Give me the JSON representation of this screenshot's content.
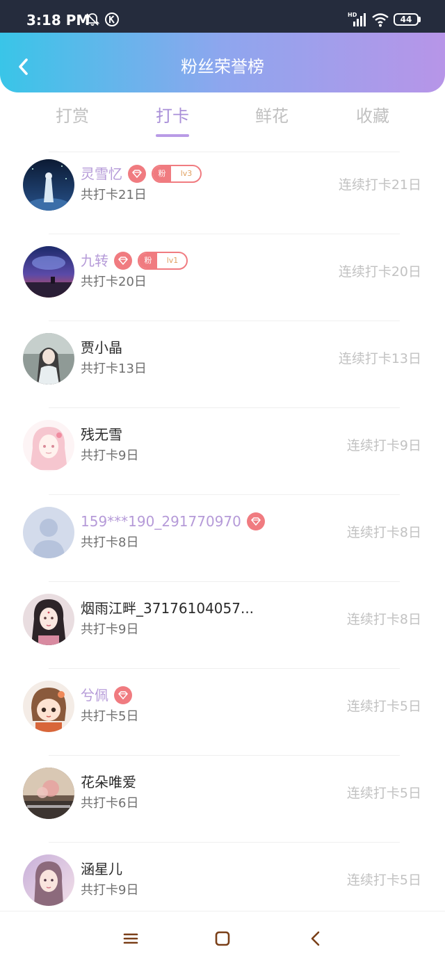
{
  "status_bar": {
    "time": "3:18 PM",
    "battery": "44",
    "icons": [
      "bell-off-icon",
      "k-icon",
      "hd-signal-icon",
      "wifi-icon",
      "battery-icon"
    ]
  },
  "header": {
    "title": "粉丝荣誉榜",
    "back_icon": "chevron-left-icon",
    "gradient": [
      "#39c5e8",
      "#b795e8"
    ]
  },
  "tabs": [
    {
      "label": "打赏",
      "active": false
    },
    {
      "label": "打卡",
      "active": true
    },
    {
      "label": "鲜花",
      "active": false
    },
    {
      "label": "收藏",
      "active": false
    }
  ],
  "fans": [
    {
      "name": "灵雪忆",
      "vip": true,
      "diamond": true,
      "fan_badge": {
        "label": "粉",
        "level": "lv3"
      },
      "total": "共打卡21日",
      "streak": "连续打卡21日"
    },
    {
      "name": "九转",
      "vip": true,
      "diamond": true,
      "fan_badge": {
        "label": "粉",
        "level": "lv1"
      },
      "total": "共打卡20日",
      "streak": "连续打卡20日"
    },
    {
      "name": "贾小晶",
      "vip": false,
      "diamond": false,
      "total": "共打卡13日",
      "streak": "连续打卡13日"
    },
    {
      "name": "残无雪",
      "vip": false,
      "diamond": false,
      "total": "共打卡9日",
      "streak": "连续打卡9日"
    },
    {
      "name": "159***190_291770970",
      "vip": true,
      "diamond": true,
      "total": "共打卡8日",
      "streak": "连续打卡8日"
    },
    {
      "name": "烟雨江畔_37176104057...",
      "vip": false,
      "diamond": false,
      "total": "共打卡9日",
      "streak": "连续打卡8日"
    },
    {
      "name": "兮佩",
      "vip": true,
      "diamond": true,
      "total": "共打卡5日",
      "streak": "连续打卡5日"
    },
    {
      "name": "花朵唯爱",
      "vip": false,
      "diamond": false,
      "total": "共打卡6日",
      "streak": "连续打卡5日"
    },
    {
      "name": "涵星儿",
      "vip": false,
      "diamond": false,
      "total": "共打卡9日",
      "streak": "连续打卡5日"
    }
  ],
  "colors": {
    "vip_name": "#b59ad8",
    "badge": "#f07b80",
    "tab_active": "#a98fd8"
  },
  "navbar": {
    "icons": [
      "menu-icon",
      "home-square-icon",
      "back-triangle-icon"
    ]
  }
}
